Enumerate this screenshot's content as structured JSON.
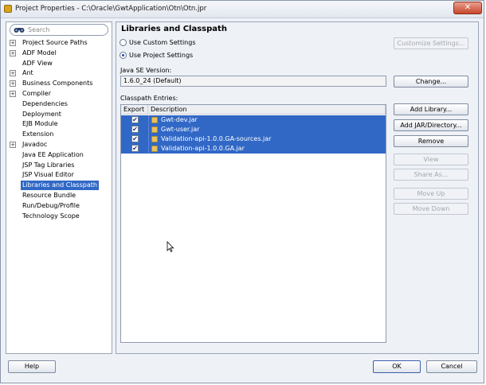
{
  "window": {
    "title": "Project Properties - C:\\Oracle\\GwtApplication\\Otn\\Otn.jpr",
    "close_glyph": "✕"
  },
  "search": {
    "placeholder": "Search"
  },
  "tree": {
    "items": [
      {
        "label": "Project Source Paths",
        "expandable": true
      },
      {
        "label": "ADF Model",
        "expandable": true
      },
      {
        "label": "ADF View",
        "expandable": false
      },
      {
        "label": "Ant",
        "expandable": true
      },
      {
        "label": "Business Components",
        "expandable": true
      },
      {
        "label": "Compiler",
        "expandable": true
      },
      {
        "label": "Dependencies",
        "expandable": false
      },
      {
        "label": "Deployment",
        "expandable": false
      },
      {
        "label": "EJB Module",
        "expandable": false
      },
      {
        "label": "Extension",
        "expandable": false
      },
      {
        "label": "Javadoc",
        "expandable": true
      },
      {
        "label": "Java EE Application",
        "expandable": false
      },
      {
        "label": "JSP Tag Libraries",
        "expandable": false
      },
      {
        "label": "JSP Visual Editor",
        "expandable": false
      },
      {
        "label": "Libraries and Classpath",
        "expandable": false,
        "selected": true
      },
      {
        "label": "Resource Bundle",
        "expandable": false
      },
      {
        "label": "Run/Debug/Profile",
        "expandable": false
      },
      {
        "label": "Technology Scope",
        "expandable": false
      }
    ]
  },
  "panel": {
    "title": "Libraries and Classpath",
    "use_custom_label": "Use Custom Settings",
    "use_project_label": "Use Project Settings",
    "customize_label": "Customize Settings...",
    "java_se_label": "Java SE Version:",
    "java_se_value": "1.6.0_24 (Default)",
    "change_label": "Change...",
    "classpath_label": "Classpath Entries:",
    "col_export": "Export",
    "col_description": "Description",
    "entries": [
      {
        "name": "Gwt-dev.jar",
        "checked": true
      },
      {
        "name": "Gwt-user.jar",
        "checked": true
      },
      {
        "name": "Validation-api-1.0.0.GA-sources.jar",
        "checked": true
      },
      {
        "name": "Validation-api-1.0.0.GA.jar",
        "checked": true
      }
    ],
    "check_glyph": "✔",
    "buttons": {
      "add_library": "Add Library...",
      "add_jar": "Add JAR/Directory...",
      "remove": "Remove",
      "view": "View",
      "share_as": "Share As...",
      "move_up": "Move Up",
      "move_down": "Move Down"
    }
  },
  "footer": {
    "help": "Help",
    "ok": "OK",
    "cancel": "Cancel"
  }
}
